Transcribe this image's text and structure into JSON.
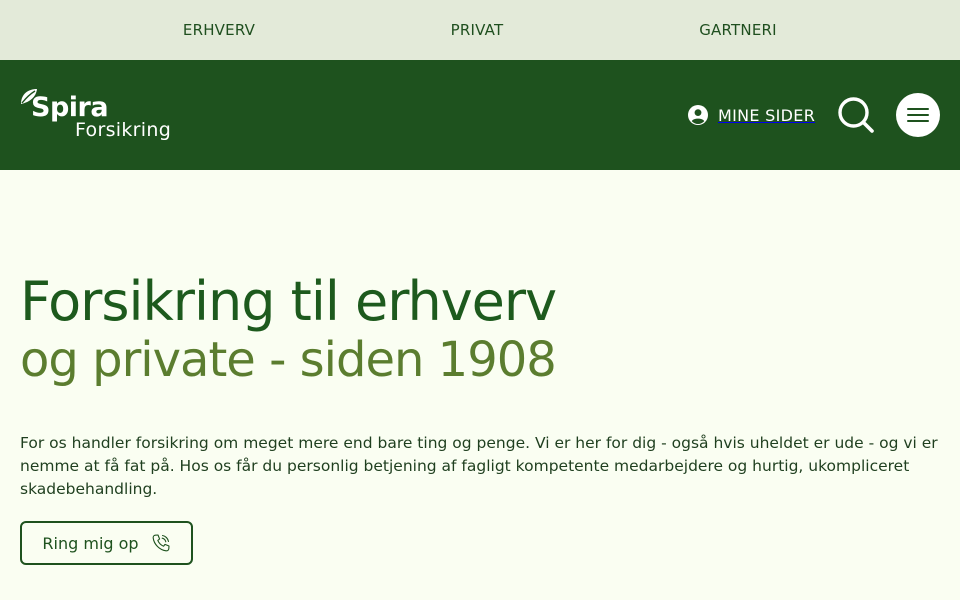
{
  "topnav": {
    "items": [
      "ERHVERV",
      "PRIVAT",
      "GARTNERI"
    ]
  },
  "header": {
    "logo": {
      "line1": "Spira",
      "line2": "Forsikring"
    },
    "account_label": "MINE SIDER",
    "icons": {
      "account": "user-circle-icon",
      "search": "search-icon",
      "menu": "hamburger-menu-icon"
    }
  },
  "hero": {
    "title_line1": "Forsikring til erhverv",
    "title_line2": "og private - siden 1908",
    "lead": "For os handler forsikring om meget mere end bare ting og penge. Vi er her for dig - også hvis uheldet er ude - og vi er nemme at få fat på. Hos os får du personlig betjening af fagligt kompetente medarbejdere og hurtig, ukompliceret skadebehandling.",
    "cta_label": "Ring mig op",
    "cta_icon": "phone-icon"
  },
  "colors": {
    "header_bg": "#1e521e",
    "topnav_bg": "#e3ead9",
    "page_bg": "#fafef2",
    "title_primary": "#1d5a1d",
    "title_secondary": "#5b7d2f"
  }
}
